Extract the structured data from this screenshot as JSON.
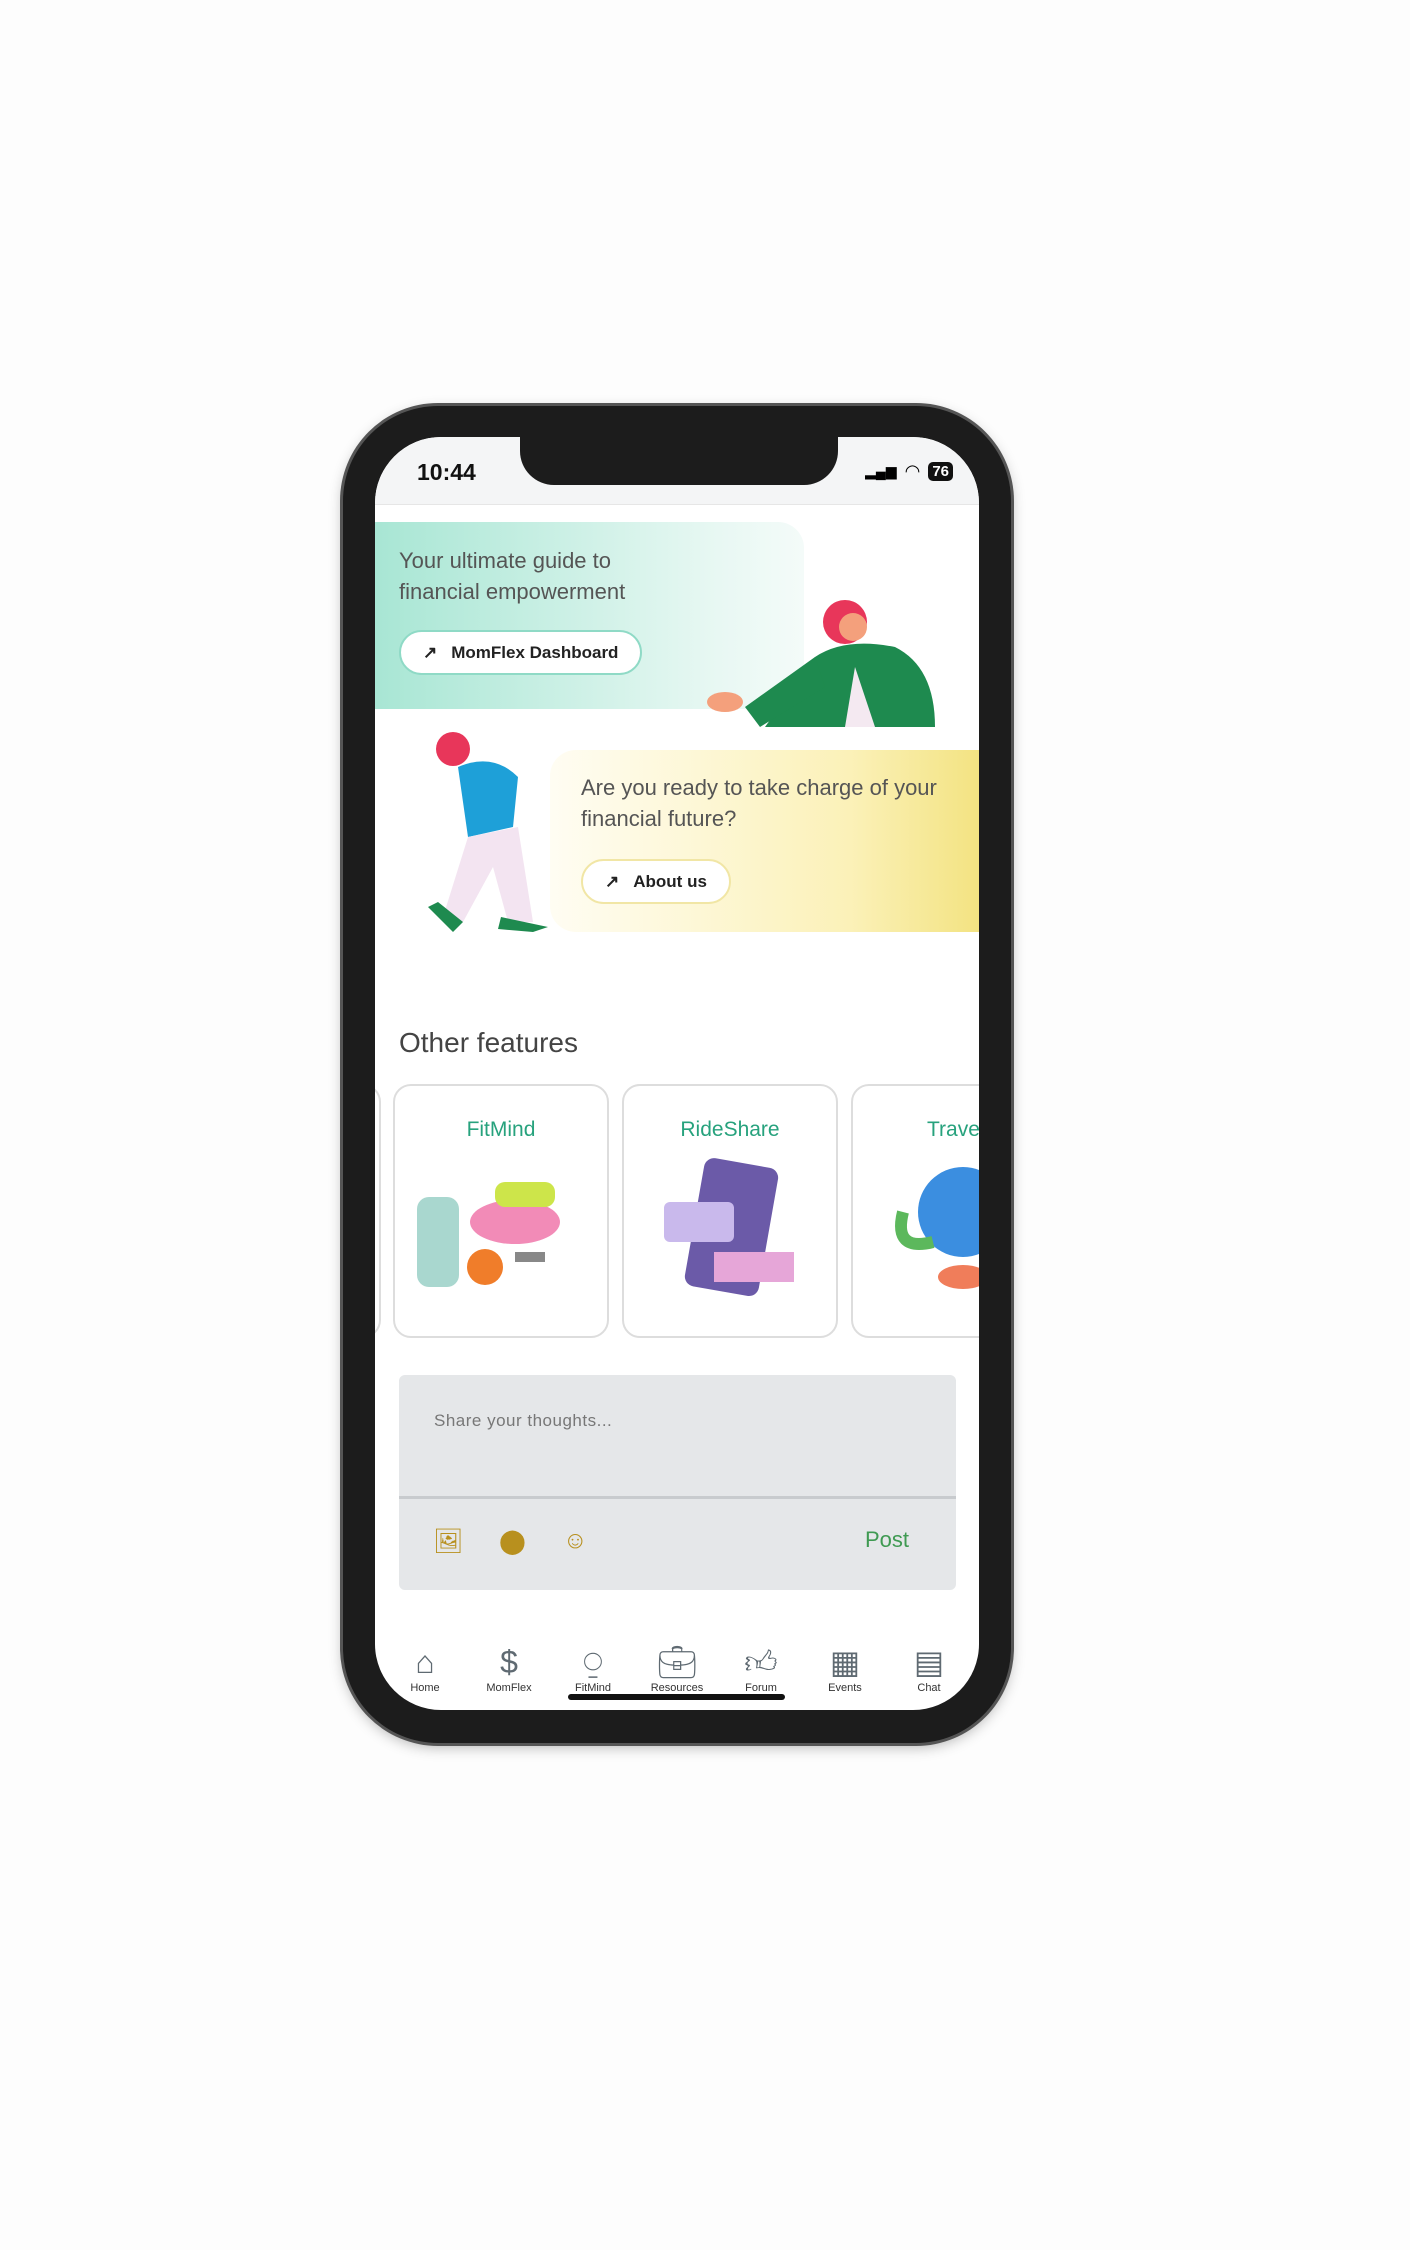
{
  "status": {
    "time": "10:44",
    "battery": "76"
  },
  "hero": {
    "text": "Your ultimate guide to financial empowerment",
    "button": "MomFlex Dashboard"
  },
  "about": {
    "text": "Are you ready to take charge of your financial future?",
    "button": "About us"
  },
  "features": {
    "title": "Other features",
    "items": [
      {
        "label": "FitMind"
      },
      {
        "label": "RideShare"
      },
      {
        "label": "Trave"
      }
    ]
  },
  "composer": {
    "placeholder": "Share your thoughts...",
    "post": "Post",
    "icons": [
      "image-icon",
      "location-pin-icon",
      "emoji-icon"
    ]
  },
  "nav": [
    {
      "label": "Home",
      "icon": "home-icon"
    },
    {
      "label": "MomFlex",
      "icon": "dollar-icon"
    },
    {
      "label": "FitMind",
      "icon": "monitor-heart-icon"
    },
    {
      "label": "Resources",
      "icon": "briefcase-icon"
    },
    {
      "label": "Forum",
      "icon": "thumbs-up-icon"
    },
    {
      "label": "Events",
      "icon": "calendar-icon"
    },
    {
      "label": "Chat",
      "icon": "chat-icon"
    }
  ],
  "colors": {
    "accent": "#27a27d",
    "post": "#3f9a52",
    "icon": "#b8901e",
    "nav": "#5f6a72"
  }
}
